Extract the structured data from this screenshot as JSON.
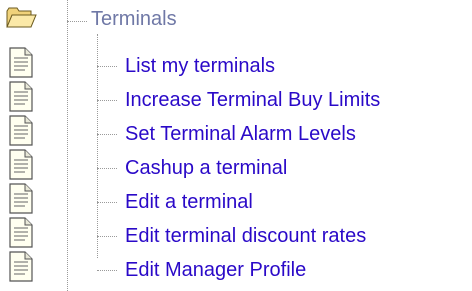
{
  "tree": {
    "root": {
      "label": "Terminals",
      "icon": "open-folder-icon"
    },
    "items": [
      {
        "label": "List my terminals",
        "icon": "document-icon"
      },
      {
        "label": "Increase Terminal Buy Limits",
        "icon": "document-icon"
      },
      {
        "label": "Set Terminal Alarm Levels",
        "icon": "document-icon"
      },
      {
        "label": "Cashup a terminal",
        "icon": "document-icon"
      },
      {
        "label": "Edit a terminal",
        "icon": "document-icon"
      },
      {
        "label": "Edit terminal discount rates",
        "icon": "document-icon"
      },
      {
        "label": "Edit Manager Profile",
        "icon": "document-icon"
      }
    ],
    "colors": {
      "root_text": "#6f78a6",
      "link_text": "#2a09c8",
      "tree_lines": "#9a9a9a",
      "folder": "#f0d27a",
      "document": "#fffff0"
    }
  }
}
